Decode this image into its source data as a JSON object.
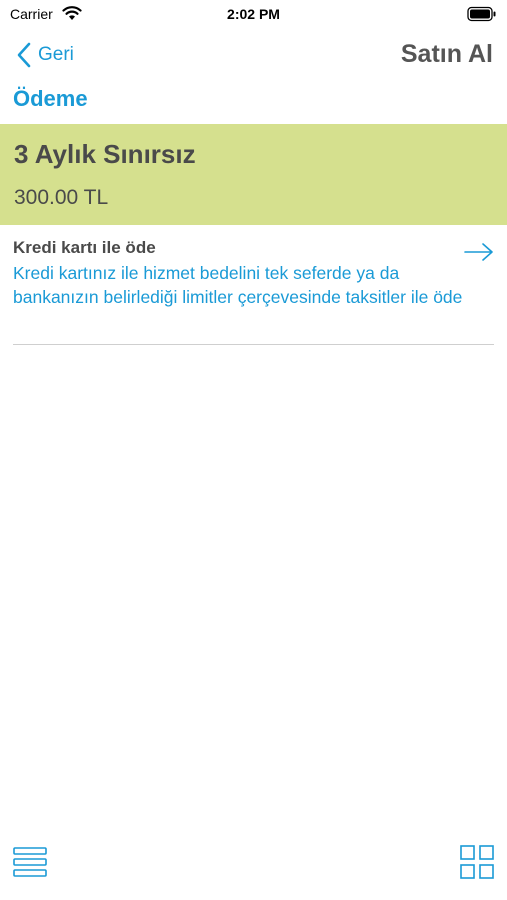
{
  "status_bar": {
    "carrier": "Carrier",
    "time": "2:02 PM"
  },
  "nav": {
    "back_label": "Geri",
    "title": "Satın Al"
  },
  "section": {
    "title": "Ödeme"
  },
  "product": {
    "name": "3 Aylık Sınırsız",
    "price": "300.00 TL",
    "background_color": "#d5e08e"
  },
  "payment_options": [
    {
      "title": "Kredi kartı ile öde",
      "description": "Kredi kartınız ile hizmet bedelini tek seferde ya da bankanızın belirlediği limitler çerçevesinde taksitler ile öde",
      "icon": "arrow-right-icon"
    }
  ],
  "toolbar": {
    "left_icon": "menu-icon",
    "right_icon": "grid-icon"
  },
  "colors": {
    "accent": "#1a9ad6",
    "text": "#4a4a4a"
  }
}
